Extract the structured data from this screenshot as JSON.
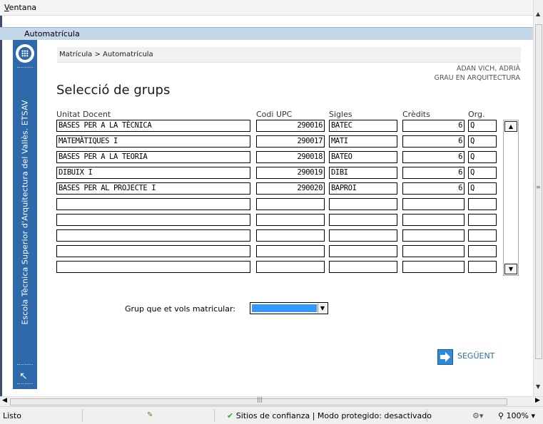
{
  "window": {
    "menu": "Ventana",
    "header": "Automatrícula"
  },
  "sidebar": {
    "school": "Escola Tècnica Superior d'Arquitectura del Vallès. ETSAV"
  },
  "page": {
    "breadcrumb": "Matrícula > Automatrícula",
    "student_name": "ADAN VICH, ADRIÀ",
    "student_degree": "GRAU EN ARQUITECTURA",
    "title": "Selecció de grups"
  },
  "table": {
    "columns": [
      "Unitat Docent",
      "Codi UPC",
      "Sigles",
      "Crèdits",
      "Org."
    ],
    "rows": [
      {
        "unitat": "BASES PER A LA TÈCNICA",
        "codi": "290016",
        "sigles": "BATEC",
        "credits": "6",
        "org": "Q"
      },
      {
        "unitat": "MATEMÀTIQUES I",
        "codi": "290017",
        "sigles": "MATI",
        "credits": "6",
        "org": "Q"
      },
      {
        "unitat": "BASES PER A LA TEORIA",
        "codi": "290018",
        "sigles": "BATEO",
        "credits": "6",
        "org": "Q"
      },
      {
        "unitat": "DIBUIX I",
        "codi": "290019",
        "sigles": "DIBI",
        "credits": "6",
        "org": "Q"
      },
      {
        "unitat": "BASES PER AL PROJECTE I",
        "codi": "290020",
        "sigles": "BAPROI",
        "credits": "6",
        "org": "Q"
      },
      {
        "unitat": "",
        "codi": "",
        "sigles": "",
        "credits": "",
        "org": ""
      },
      {
        "unitat": "",
        "codi": "",
        "sigles": "",
        "credits": "",
        "org": ""
      },
      {
        "unitat": "",
        "codi": "",
        "sigles": "",
        "credits": "",
        "org": ""
      },
      {
        "unitat": "",
        "codi": "",
        "sigles": "",
        "credits": "",
        "org": ""
      },
      {
        "unitat": "",
        "codi": "",
        "sigles": "",
        "credits": "",
        "org": ""
      }
    ]
  },
  "grupo": {
    "label": "Grup que et vols matricular:",
    "selected": ""
  },
  "next": {
    "label": "SEGÜENT"
  },
  "statusbar": {
    "status": "Listo",
    "zone": "Sitios de confianza | Modo protegido: desactivado",
    "zoom": "100%"
  },
  "colors": {
    "sidebar": "#2e6aa9",
    "header_strip": "#c5d8ea",
    "selection": "#3399ff",
    "link": "#2b6cb1"
  }
}
